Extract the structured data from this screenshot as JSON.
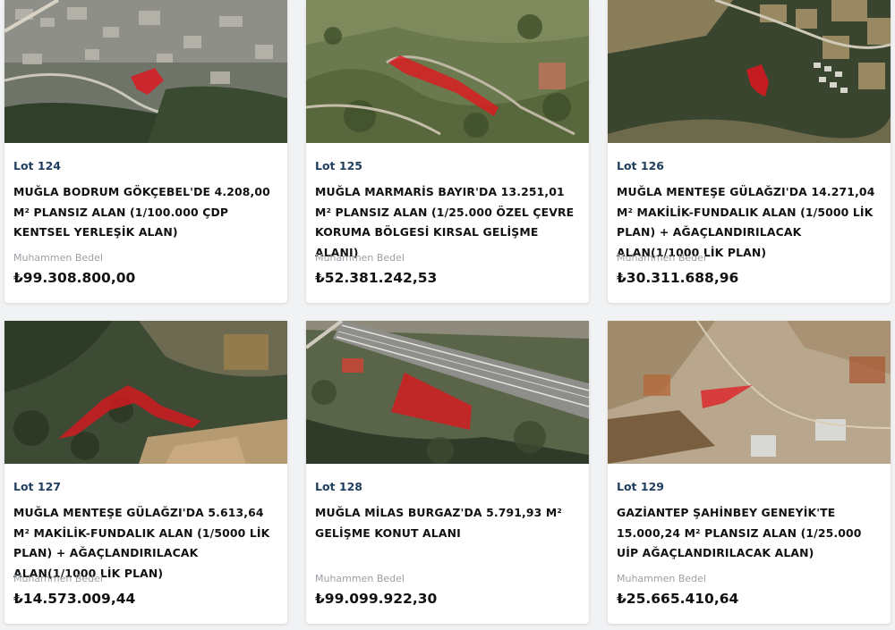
{
  "lots": [
    {
      "lot": "Lot 124",
      "title": "MUĞLA BODRUM GÖKÇEBEL'DE 4.208,00 M² PLANSIZ ALAN (1/100.000 ÇDP KENTSEL YERLEŞİK ALAN)",
      "price_label": "Muhammen Bedel",
      "price": "₺99.308.800,00"
    },
    {
      "lot": "Lot 125",
      "title": "MUĞLA MARMARİS BAYIR'DA 13.251,01 M² PLANSIZ ALAN (1/25.000 ÖZEL ÇEVRE KORUMA BÖLGESİ KIRSAL GELİŞME ALANI)",
      "price_label": "Muhammen Bedel",
      "price": "₺52.381.242,53"
    },
    {
      "lot": "Lot 126",
      "title": "MUĞLA MENTEŞE GÜLAĞZI'DA 14.271,04 M² MAKİLİK-FUNDALIK ALAN (1/5000 LİK PLAN) + AĞAÇLANDIRILACAK ALAN(1/1000 LİK PLAN)",
      "price_label": "Muhammen Bedel",
      "price": "₺30.311.688,96"
    },
    {
      "lot": "Lot 127",
      "title": "MUĞLA MENTEŞE GÜLAĞZI'DA 5.613,64 M² MAKİLİK-FUNDALIK ALAN (1/5000 LİK PLAN) + AĞAÇLANDIRILACAK ALAN(1/1000 LİK PLAN)",
      "price_label": "Muhammen Bedel",
      "price": "₺14.573.009,44"
    },
    {
      "lot": "Lot 128",
      "title": "MUĞLA MİLAS BURGAZ'DA 5.791,93 M² GELİŞME KONUT ALANI",
      "price_label": "Muhammen Bedel",
      "price": "₺99.099.922,30"
    },
    {
      "lot": "Lot 129",
      "title": "GAZİANTEP ŞAHİNBEY GENEYİK'TE 15.000,24 M² PLANSIZ ALAN (1/25.000 UİP AĞAÇLANDIRILACAK ALAN)",
      "price_label": "Muhammen Bedel",
      "price": "₺25.665.410,64"
    }
  ],
  "colors": {
    "lot_label": "#1f3d5c",
    "parcel_highlight": "#e3141e",
    "muted_label": "#9aa0a6"
  },
  "icons": [
    "satellite-map-thumbnail",
    "parcel-polygon"
  ]
}
